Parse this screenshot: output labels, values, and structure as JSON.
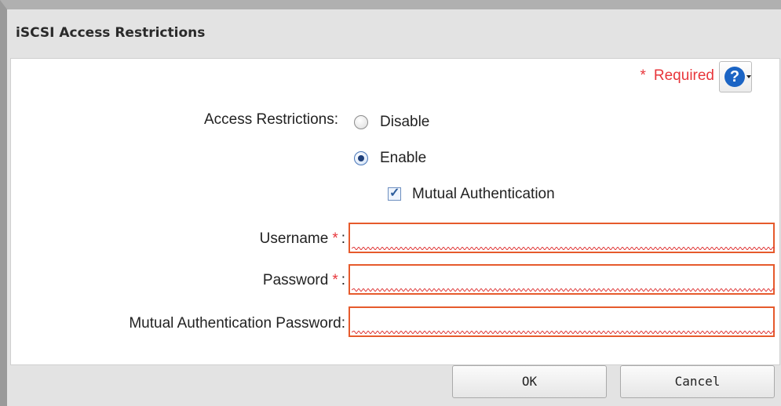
{
  "dialog": {
    "title": "iSCSI Access Restrictions",
    "required_star": "*",
    "required_label": "Required",
    "help_icon": "question-circle-icon"
  },
  "form": {
    "access_restrictions_label": "Access Restrictions:",
    "options": [
      {
        "label": "Disable",
        "selected": false
      },
      {
        "label": "Enable",
        "selected": true
      }
    ],
    "mutual_auth_label": "Mutual Authentication",
    "mutual_auth_checked": true,
    "username_label": "Username",
    "password_label": "Password",
    "mutual_password_label": "Mutual Authentication Password:",
    "required_marker": "*",
    "colon": ":",
    "username_value": "",
    "password_value": "",
    "mutual_password_value": ""
  },
  "buttons": {
    "ok": "OK",
    "cancel": "Cancel"
  },
  "colors": {
    "required": "#e8363b",
    "field_border": "#e65a2c",
    "help": "#1b64c4"
  }
}
